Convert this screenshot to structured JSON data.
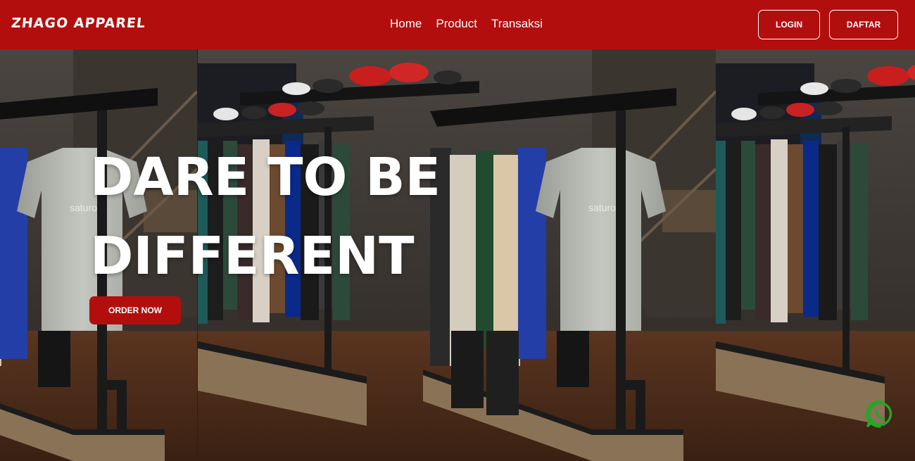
{
  "navbar": {
    "brand": "ZHAGO APPAREL",
    "links": [
      "Home",
      "Product",
      "Transaksi"
    ],
    "login_label": "LOGIN",
    "daftar_label": "DAFTAR"
  },
  "hero": {
    "title_line1": "DARE TO BE",
    "title_line2": "DIFFERENT",
    "cta_label": "ORDER NOW"
  },
  "floating": {
    "whatsapp_icon": "whatsapp-icon"
  },
  "colors": {
    "brand_red": "#b30e0e",
    "whatsapp_green": "#25a626",
    "text_white": "#ffffff"
  }
}
